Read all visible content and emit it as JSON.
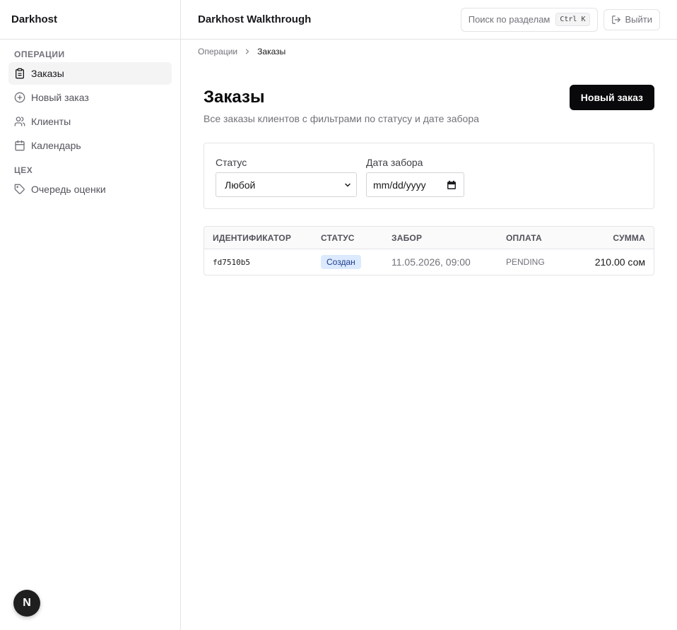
{
  "sidebar": {
    "brand": "Darkhost",
    "sections": [
      {
        "title": "ОПЕРАЦИИ",
        "items": [
          {
            "label": "Заказы",
            "icon": "clipboard-icon",
            "active": true
          },
          {
            "label": "Новый заказ",
            "icon": "plus-circle-icon"
          },
          {
            "label": "Клиенты",
            "icon": "users-icon"
          },
          {
            "label": "Календарь",
            "icon": "calendar-icon"
          }
        ]
      },
      {
        "title": "ЦЕХ",
        "items": [
          {
            "label": "Очередь оценки",
            "icon": "tag-icon"
          }
        ]
      }
    ],
    "badge": "N"
  },
  "header": {
    "title": "Darkhost Walkthrough",
    "search_label": "Поиск по разделам",
    "search_shortcut": "Ctrl K",
    "logout_label": "Выйти"
  },
  "breadcrumb": {
    "parent": "Операции",
    "current": "Заказы"
  },
  "page": {
    "title": "Заказы",
    "subtitle": "Все заказы клиентов с фильтрами по статусу и дате забора",
    "new_order_button": "Новый заказ"
  },
  "filters": {
    "status_label": "Статус",
    "status_value": "Любой",
    "date_label": "Дата забора",
    "date_placeholder": "mm/dd/yyyy"
  },
  "table": {
    "columns": [
      "ИДЕНТИФИКАТОР",
      "СТАТУС",
      "ЗАБОР",
      "ОПЛАТА",
      "СУММА"
    ],
    "rows": [
      {
        "id": "fd7510b5",
        "status": "Создан",
        "pickup": "11.05.2026, 09:00",
        "payment": "PENDING",
        "amount": "210.00 сом"
      }
    ]
  },
  "colors": {
    "accent": "#09090b",
    "status_badge_bg": "#dbeafe",
    "status_badge_text": "#1e3a8a"
  }
}
